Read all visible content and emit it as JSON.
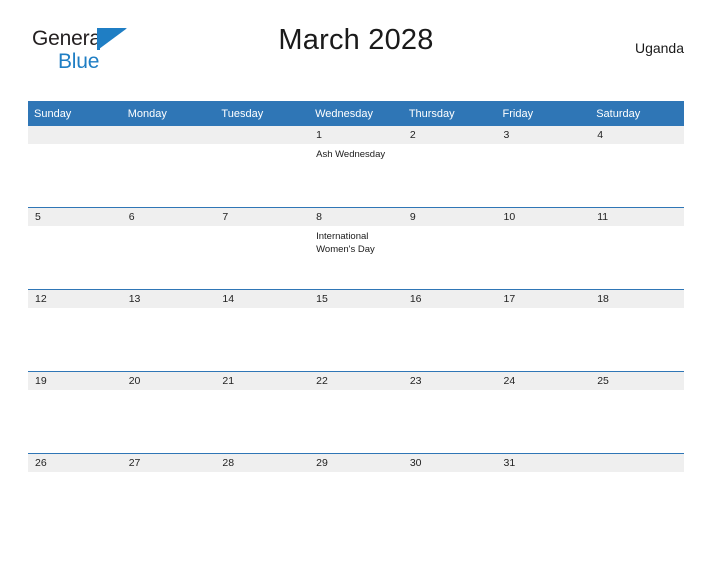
{
  "brand": {
    "name_part1": "General",
    "name_part2": "Blue",
    "triangle_color": "#1f7ec4"
  },
  "header": {
    "title": "March 2028",
    "locale": "Uganda"
  },
  "colors": {
    "header_blue": "#2f76b6",
    "daynum_band": "#efefef",
    "brand_blue": "#1f7ec4",
    "text": "#1a1a1a"
  },
  "calendar": {
    "weekday_headers": [
      "Sunday",
      "Monday",
      "Tuesday",
      "Wednesday",
      "Thursday",
      "Friday",
      "Saturday"
    ],
    "weeks": [
      [
        {
          "day": "",
          "events": []
        },
        {
          "day": "",
          "events": []
        },
        {
          "day": "",
          "events": []
        },
        {
          "day": "1",
          "events": [
            "Ash Wednesday"
          ]
        },
        {
          "day": "2",
          "events": []
        },
        {
          "day": "3",
          "events": []
        },
        {
          "day": "4",
          "events": []
        }
      ],
      [
        {
          "day": "5",
          "events": []
        },
        {
          "day": "6",
          "events": []
        },
        {
          "day": "7",
          "events": []
        },
        {
          "day": "8",
          "events": [
            "International",
            "Women's Day"
          ]
        },
        {
          "day": "9",
          "events": []
        },
        {
          "day": "10",
          "events": []
        },
        {
          "day": "11",
          "events": []
        }
      ],
      [
        {
          "day": "12",
          "events": []
        },
        {
          "day": "13",
          "events": []
        },
        {
          "day": "14",
          "events": []
        },
        {
          "day": "15",
          "events": []
        },
        {
          "day": "16",
          "events": []
        },
        {
          "day": "17",
          "events": []
        },
        {
          "day": "18",
          "events": []
        }
      ],
      [
        {
          "day": "19",
          "events": []
        },
        {
          "day": "20",
          "events": []
        },
        {
          "day": "21",
          "events": []
        },
        {
          "day": "22",
          "events": []
        },
        {
          "day": "23",
          "events": []
        },
        {
          "day": "24",
          "events": []
        },
        {
          "day": "25",
          "events": []
        }
      ],
      [
        {
          "day": "26",
          "events": []
        },
        {
          "day": "27",
          "events": []
        },
        {
          "day": "28",
          "events": []
        },
        {
          "day": "29",
          "events": []
        },
        {
          "day": "30",
          "events": []
        },
        {
          "day": "31",
          "events": []
        },
        {
          "day": "",
          "events": []
        }
      ]
    ]
  }
}
